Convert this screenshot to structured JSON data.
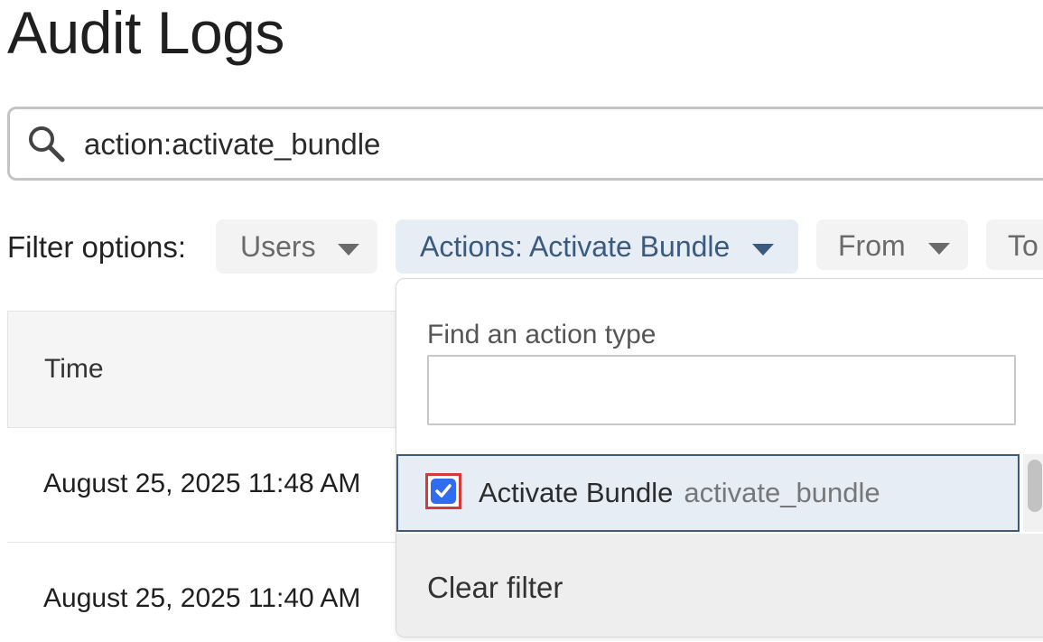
{
  "page": {
    "title": "Audit Logs"
  },
  "search": {
    "value": "action:activate_bundle",
    "icon": "search-icon"
  },
  "filters": {
    "label": "Filter options:",
    "users": "Users",
    "actions": "Actions: Activate Bundle",
    "from": "From",
    "to": "To",
    "active_color": "#3a5a80"
  },
  "table": {
    "header_time": "Time",
    "rows": [
      {
        "time": "August 25, 2025 11:48 AM"
      },
      {
        "time": "August 25, 2025 11:40 AM"
      }
    ]
  },
  "dropdown": {
    "find_label": "Find an action type",
    "find_value": "",
    "options": [
      {
        "label": "Activate Bundle",
        "code": "activate_bundle",
        "checked": true
      }
    ],
    "clear_label": "Clear filter"
  }
}
